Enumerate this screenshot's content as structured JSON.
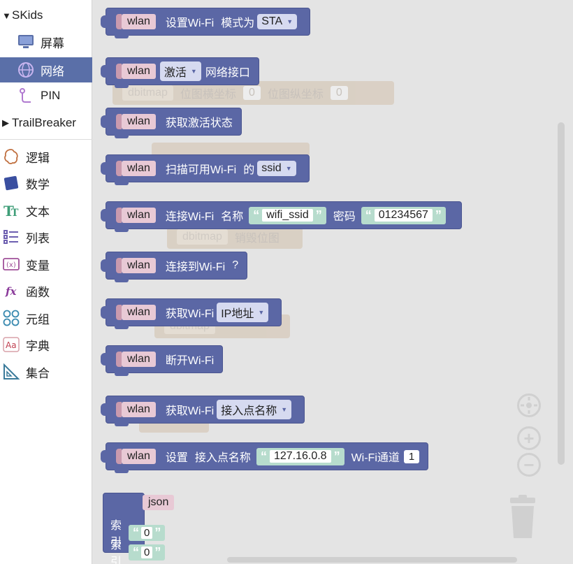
{
  "toolbox": {
    "categories": [
      {
        "label": "SKids",
        "type": "group"
      },
      {
        "label": "屏幕",
        "icon": "monitor-icon"
      },
      {
        "label": "网络",
        "icon": "globe-icon",
        "selected": true
      },
      {
        "label": "PIN",
        "icon": "pin-icon"
      },
      {
        "label": "TrailBreaker",
        "type": "group"
      },
      {
        "label": "逻辑",
        "icon": "brain-icon"
      },
      {
        "label": "数学",
        "icon": "math-icon"
      },
      {
        "label": "文本",
        "icon": "text-icon"
      },
      {
        "label": "列表",
        "icon": "list-icon"
      },
      {
        "label": "变量",
        "icon": "variable-icon"
      },
      {
        "label": "函数",
        "icon": "function-icon"
      },
      {
        "label": "元组",
        "icon": "tuple-icon"
      },
      {
        "label": "字典",
        "icon": "dictionary-icon"
      },
      {
        "label": "集合",
        "icon": "set-icon"
      }
    ]
  },
  "blocks": {
    "b1": {
      "chip": "wlan",
      "label1": "设置Wi-Fi",
      "label2": "模式为",
      "dropdown": "STA"
    },
    "b2": {
      "chip": "wlan",
      "dropdown": "激活",
      "label1": "网络接口"
    },
    "b3": {
      "chip": "wlan",
      "label1": "获取激活状态"
    },
    "b4": {
      "chip": "wlan",
      "label1": "扫描可用Wi-Fi",
      "label2": "的",
      "dropdown": "ssid"
    },
    "b5": {
      "chip": "wlan",
      "label1": "连接Wi-Fi",
      "label2": "名称",
      "ssid_value": "wifi_ssid",
      "label3": "密码",
      "password_value": "01234567"
    },
    "b6": {
      "chip": "wlan",
      "label1": "连接到Wi-Fi",
      "label2": "?"
    },
    "b7": {
      "chip": "wlan",
      "label1": "获取Wi-Fi",
      "dropdown": "IP地址"
    },
    "b8": {
      "chip": "wlan",
      "label1": "断开Wi-Fi"
    },
    "b9": {
      "chip": "wlan",
      "label1": "获取Wi-Fi",
      "dropdown": "接入点名称"
    },
    "b10": {
      "chip": "wlan",
      "label1": "设置",
      "label2": "接入点名称",
      "ap_value": "127.16.0.8",
      "label3": "Wi-Fi通道",
      "channel": "1"
    },
    "json": {
      "chip": "json",
      "index_label_1": "索引",
      "index_value_1": "0",
      "index_label_2": "索引",
      "index_value_2": "0"
    }
  },
  "ghosts": {
    "g1": {
      "chip": "dbitmap",
      "label1": "位图横坐标",
      "v1": "0",
      "label2": "位图纵坐标",
      "v2": "0"
    },
    "g3": {
      "chip": "dbitmap",
      "label1": "销毁位图"
    },
    "g4": {
      "chip": "dbitmap"
    }
  },
  "quote_open": "“",
  "quote_close": "”",
  "colors": {
    "block": "#5b67a5",
    "chip": "#e8c9d5",
    "string": "#b7dccd",
    "selected": "#5a6fa8"
  }
}
